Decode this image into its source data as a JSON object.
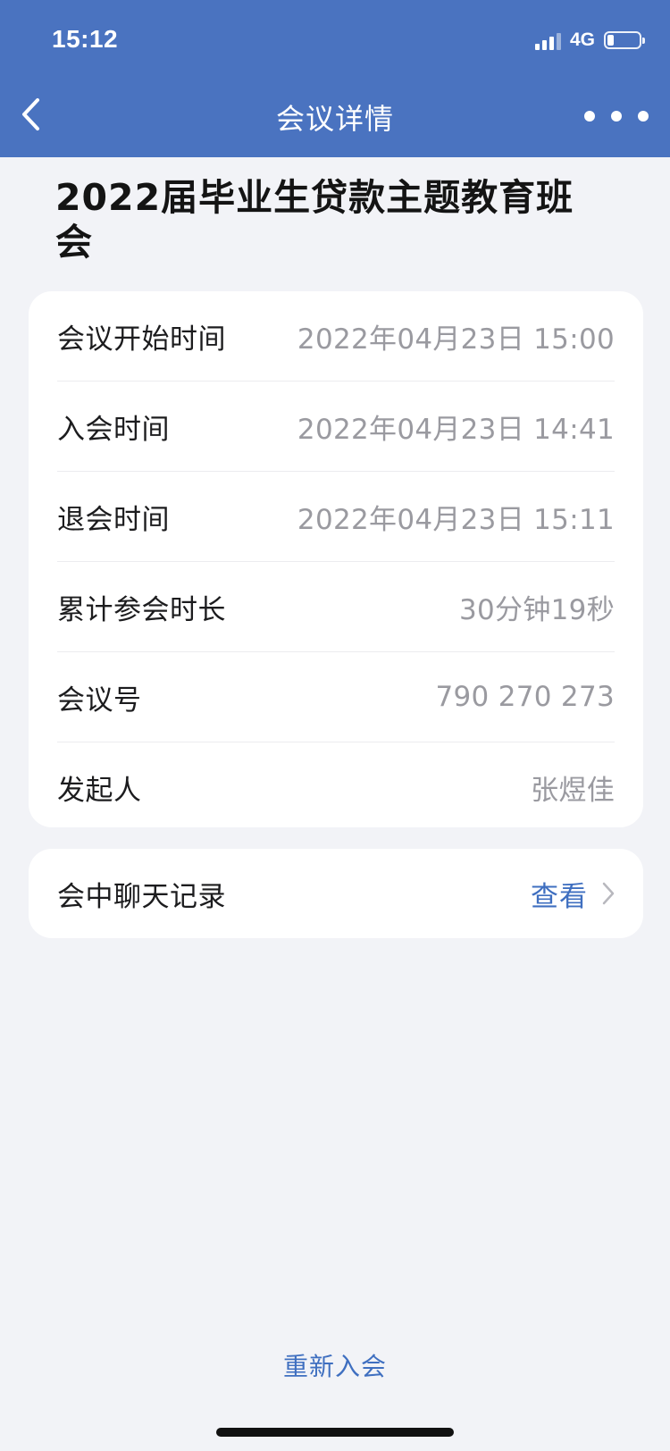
{
  "status_bar": {
    "time": "15:12",
    "network": "4G",
    "battery_level": 0.2,
    "icons": [
      "signal-icon",
      "battery-icon"
    ]
  },
  "nav": {
    "title": "会议详情",
    "back_icon": "chevron-left-icon",
    "more_icon": "more-icon"
  },
  "meeting": {
    "title": "2022届毕业生贷款主题教育班会"
  },
  "details": [
    {
      "label": "会议开始时间",
      "value": "2022年04月23日 15:00"
    },
    {
      "label": "入会时间",
      "value": "2022年04月23日 14:41"
    },
    {
      "label": "退会时间",
      "value": "2022年04月23日 15:11"
    },
    {
      "label": "累计参会时长",
      "value": "30分钟19秒"
    },
    {
      "label": "会议号",
      "value": "790 270 273"
    },
    {
      "label": "发起人",
      "value": "张煜佳"
    }
  ],
  "chat": {
    "label": "会中聊天记录",
    "action": "查看",
    "icon": "chevron-right-icon"
  },
  "footer": {
    "rejoin_label": "重新入会"
  },
  "colors": {
    "header_bg": "#4a73c0",
    "page_bg": "#f2f3f7",
    "link": "#3f6fc0",
    "value_text": "#9a9aa0"
  }
}
